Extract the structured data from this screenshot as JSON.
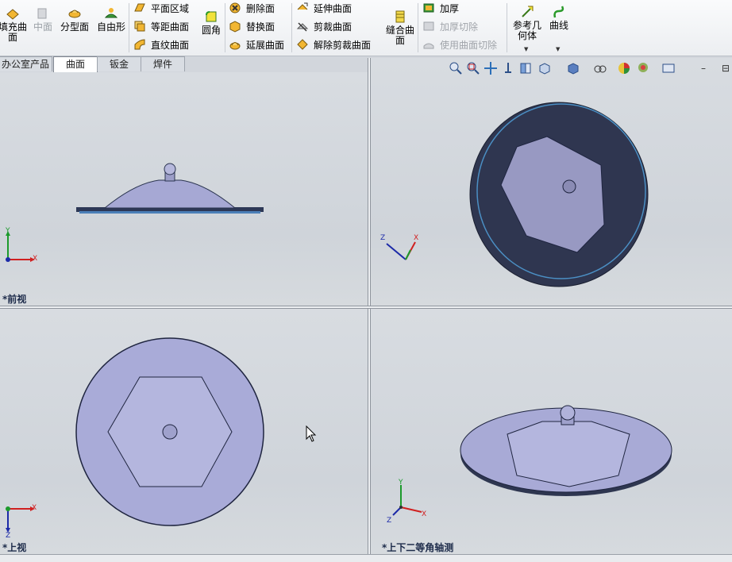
{
  "ribbon": {
    "buttons": {
      "fill_surface": "填充曲面",
      "mid_surface": "中面",
      "parting_surface": "分型面",
      "freeform": "自由形",
      "fillet": "圆角",
      "knit_surface": "缝合曲面",
      "ref_geometry": "参考几何体",
      "curves": "曲线"
    },
    "col1": {
      "planar": "平面区域",
      "offset": "等距曲面",
      "ruled": "直纹曲面"
    },
    "col2": {
      "delete_face": "删除面",
      "replace_face": "替换面",
      "extend_face": "延展曲面"
    },
    "col3": {
      "extend": "延伸曲面",
      "trim": "剪裁曲面",
      "untrim": "解除剪裁曲面"
    },
    "col4": {
      "thicken": "加厚",
      "thicken_cut": "加厚切除",
      "surface_cut": "使用曲面切除"
    }
  },
  "tabs": [
    {
      "label": "办公室产品"
    },
    {
      "label": "曲面",
      "active": true
    },
    {
      "label": "钣金"
    },
    {
      "label": "焊件"
    }
  ],
  "viewports": {
    "front": "*前视",
    "isometric": "",
    "top": "*上视",
    "trimetric": "*上下二等角轴测"
  },
  "axes": {
    "x": "X",
    "y": "Y",
    "z": "Z"
  },
  "hud_icons": [
    "zoom-fit-icon",
    "zoom-area-icon",
    "pan-icon",
    "rotate-icon",
    "section-view-icon",
    "view-orientation-icon",
    "display-style-icon",
    "hide-show-icon",
    "appearance-icon",
    "scene-icon",
    "view-settings-icon"
  ],
  "colors": {
    "part": "#a9abd8",
    "part_edge": "#2b3550",
    "viewport_bg": "#d3d7dc",
    "axis_x": "#d02020",
    "axis_y": "#1c9a2c",
    "axis_z": "#1c2aa8"
  }
}
